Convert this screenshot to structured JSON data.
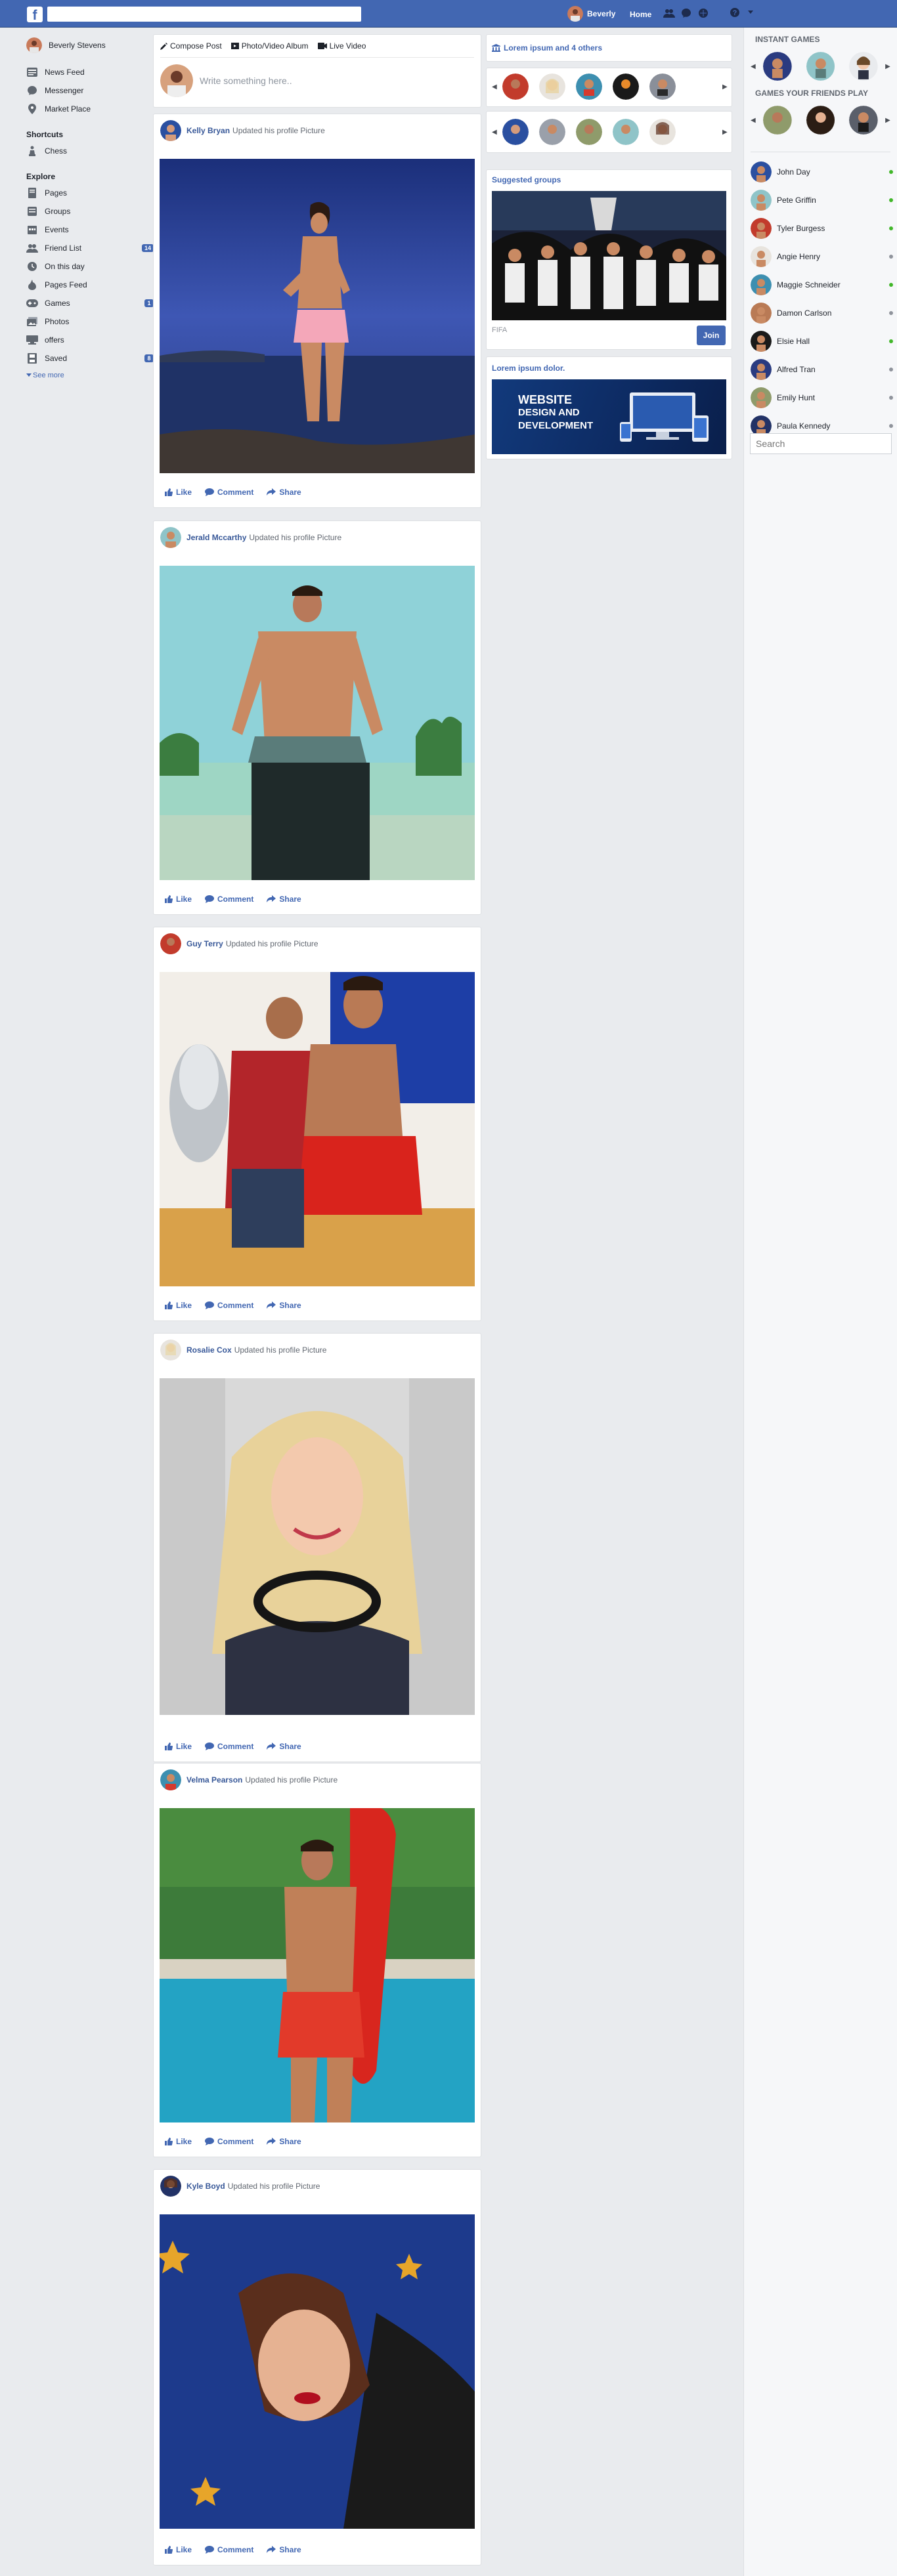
{
  "topbar": {
    "logo_letter": "f",
    "search_placeholder": "",
    "user_name": "Beverly",
    "home_label": "Home",
    "icons": [
      "friends-icon",
      "messages-icon",
      "notifications-icon",
      "help-icon",
      "dropdown-icon"
    ]
  },
  "leftnav": {
    "profile_name": "Beverly Stevens",
    "main_items": [
      {
        "label": "News Feed",
        "icon": "newsfeed-icon"
      },
      {
        "label": "Messenger",
        "icon": "messenger-icon"
      },
      {
        "label": "Market Place",
        "icon": "marketplace-icon"
      }
    ],
    "shortcuts_heading": "Shortcuts",
    "shortcuts": [
      {
        "label": "Chess",
        "icon": "chess-icon"
      }
    ],
    "explore_heading": "Explore",
    "explore": [
      {
        "label": "Pages",
        "icon": "pages-icon",
        "count": ""
      },
      {
        "label": "Groups",
        "icon": "groups-icon",
        "count": ""
      },
      {
        "label": "Events",
        "icon": "events-icon",
        "count": ""
      },
      {
        "label": "Friend List",
        "icon": "friend-list-icon",
        "count": "14"
      },
      {
        "label": "On this day",
        "icon": "on-this-day-icon",
        "count": ""
      },
      {
        "label": "Pages Feed",
        "icon": "pages-feed-icon",
        "count": ""
      },
      {
        "label": "Games",
        "icon": "games-icon",
        "count": "1"
      },
      {
        "label": "Photos",
        "icon": "photos-icon",
        "count": ""
      },
      {
        "label": "offers",
        "icon": "offers-icon",
        "count": ""
      },
      {
        "label": "Saved",
        "icon": "saved-icon",
        "count": "8"
      }
    ],
    "see_more": "See more"
  },
  "composer": {
    "tabs": [
      {
        "label": "Compose Post",
        "icon": "pencil-icon"
      },
      {
        "label": "Photo/Video Album",
        "icon": "video-album-icon"
      },
      {
        "label": "Live Video",
        "icon": "live-video-icon"
      }
    ],
    "placeholder": "Write something here.."
  },
  "posts": [
    {
      "name": "Kelly Bryan",
      "action": "Updated his profile Picture",
      "scene": "shirtless man in pink shorts on rocks by the sea at dusk"
    },
    {
      "name": "Jerald Mccarthy",
      "action": "Updated his profile Picture",
      "scene": "shirtless man on a tropical beach"
    },
    {
      "name": "Guy Terry",
      "action": "Updated his profile Picture",
      "scene": "two footballers celebrating with a silver trophy"
    },
    {
      "name": "Rosalie Cox",
      "action": "Updated his profile Picture",
      "scene": "smiling blonde woman with headphones around neck"
    },
    {
      "name": "Velma Pearson",
      "action": "Updated his profile Picture",
      "scene": "lifeguard with red rescue float at a pool"
    },
    {
      "name": "Kyle Boyd",
      "action": "Updated his profile Picture",
      "scene": "woman lying on a blue starry blanket"
    }
  ],
  "post_actions": {
    "like": "Like",
    "comment": "Comment",
    "share": "Share"
  },
  "stories": {
    "title": "Lorem ipsum and 4 others",
    "row1_count": 5,
    "row2_count": 5
  },
  "suggested": {
    "title": "Suggested groups",
    "group_name": "FIFA",
    "join_label": "Join",
    "banner_text": "WEBSITE DESIGN AND DEVELOPMENT"
  },
  "lorem": {
    "title": "Lorem ipsum dolor.",
    "ad_text_1": "WEBSITE",
    "ad_text_2": "DESIGN AND",
    "ad_text_3": "DEVELOPMENT"
  },
  "rightpanel": {
    "instant_games": "INSTANT GAMES",
    "friends_play": "GAMES YOUR FRIENDS PLAY",
    "contacts": [
      {
        "name": "John Day",
        "online": true
      },
      {
        "name": "Pete Griffin",
        "online": true
      },
      {
        "name": "Tyler Burgess",
        "online": true
      },
      {
        "name": "Angie Henry",
        "online": false
      },
      {
        "name": "Maggie Schneider",
        "online": true
      },
      {
        "name": "Damon Carlson",
        "online": false
      },
      {
        "name": "Elsie Hall",
        "online": true
      },
      {
        "name": "Alfred Tran",
        "online": false
      },
      {
        "name": "Emily Hunt",
        "online": false
      },
      {
        "name": "Paula Kennedy",
        "online": false
      }
    ],
    "search_placeholder": "Search"
  },
  "colors": {
    "brand": "#4267b2",
    "online": "#42b72a",
    "offline": "#90949c",
    "background": "#e9ebee"
  }
}
